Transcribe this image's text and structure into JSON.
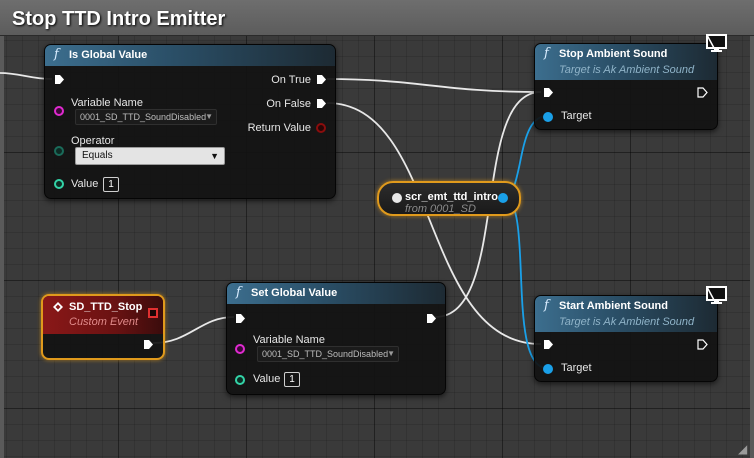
{
  "comment": {
    "title": "Stop TTD Intro Emitter"
  },
  "colors": {
    "exec_pin": "#ffffff",
    "string_pin": "#e02ad0",
    "byte_pin": "#1a6b5a",
    "int_pin": "#33d3a7",
    "bool_pin": "#8a0d0d",
    "object_pin": "#1aa0e8",
    "selection_outline": "#e09a1c",
    "event_header": "#8a1818",
    "function_header": "#3c6e8e"
  },
  "is_global_value": {
    "title": "Is Global Value",
    "icon": "function-icon",
    "pins": {
      "variable_name_label": "Variable Name",
      "variable_name_value": "0001_SD_TTD_SoundDisabled",
      "operator_label": "Operator",
      "operator_value": "Equals",
      "value_label": "Value",
      "value_value": "1",
      "on_true_label": "On True",
      "on_false_label": "On False",
      "return_value_label": "Return Value"
    }
  },
  "stop_ambient_sound": {
    "title": "Stop Ambient Sound",
    "subtitle": "Target is Ak Ambient Sound",
    "icon": "function-icon",
    "target_label": "Target"
  },
  "start_ambient_sound": {
    "title": "Start Ambient Sound",
    "subtitle": "Target is Ak Ambient Sound",
    "icon": "function-icon",
    "target_label": "Target"
  },
  "variable_node": {
    "name": "scr_emt_ttd_intro",
    "source": "from 0001_SD"
  },
  "custom_event": {
    "title": "SD_TTD_Stop",
    "subtitle": "Custom Event",
    "icon": "event-diamond-icon"
  },
  "set_global_value": {
    "title": "Set Global Value",
    "icon": "function-icon",
    "variable_name_label": "Variable Name",
    "variable_name_value": "0001_SD_TTD_SoundDisabled",
    "value_label": "Value",
    "value_value": "1"
  }
}
